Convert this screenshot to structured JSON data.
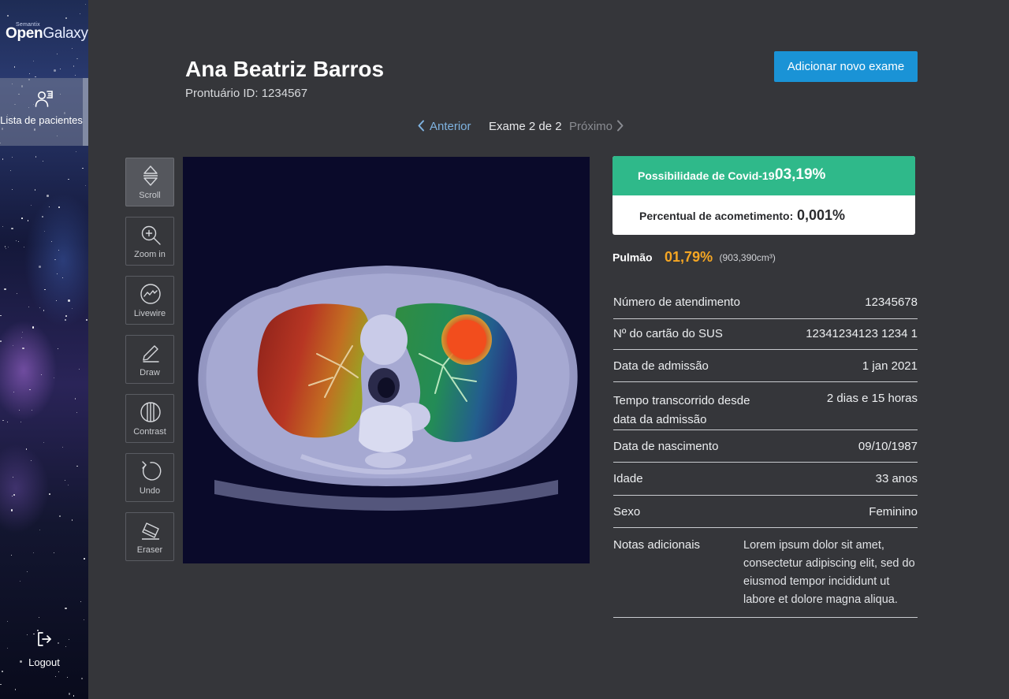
{
  "brand": {
    "sub": "Semantix",
    "name_bold": "Open",
    "name_light": "Galaxy"
  },
  "sidebar": {
    "nav_item": {
      "label": "Lista de pacientes",
      "icon": "patients-icon"
    },
    "logout": {
      "label": "Logout",
      "icon": "logout-icon"
    }
  },
  "patient": {
    "name": "Ana Beatriz Barros",
    "record_id": "Prontuário ID: 1234567"
  },
  "header": {
    "add_exam_label": "Adicionar novo exame"
  },
  "exam_nav": {
    "prev": "Anterior",
    "counter": "Exame 2 de 2",
    "next": "Próximo"
  },
  "tools": [
    {
      "label": "Scroll",
      "icon": "scroll-icon",
      "active": true
    },
    {
      "label": "Zoom in",
      "icon": "zoom-in-icon"
    },
    {
      "label": "Livewire",
      "icon": "livewire-icon"
    },
    {
      "label": "Draw",
      "icon": "pencil-icon"
    },
    {
      "label": "Contrast",
      "icon": "contrast-icon"
    },
    {
      "label": "Undo",
      "icon": "undo-icon"
    },
    {
      "label": "Eraser",
      "icon": "eraser-icon"
    }
  ],
  "results": {
    "covid_label": "Possibilidade de Covid-19:",
    "covid_value": "03,19%",
    "involvement_label": "Percentual de acometimento:",
    "involvement_value": "0,001%",
    "covid_color": "#2fb98a"
  },
  "lung": {
    "label": "Pulmão",
    "percent": "01,79%",
    "volume": "(903,390cm³)",
    "percent_color": "#f5a623"
  },
  "info": [
    {
      "key": "Número de atendimento",
      "value": "12345678"
    },
    {
      "key": "Nº do cartão do SUS",
      "value": "12341234123 1234 1"
    },
    {
      "key": "Data de admissão",
      "value": "1 jan 2021"
    },
    {
      "key": "Tempo transcorrido desde data da admissão",
      "value": "2 dias e 15 horas"
    },
    {
      "key": "Data de nascimento",
      "value": "09/10/1987"
    },
    {
      "key": "Idade",
      "value": "33 anos"
    },
    {
      "key": "Sexo",
      "value": "Feminino"
    }
  ],
  "notes": {
    "key": "Notas adicionais",
    "value": "Lorem ipsum dolor sit amet, consectetur adipiscing elit, sed do eiusmod tempor incididunt ut labore et dolore magna aliqua."
  },
  "colors": {
    "accent": "#1a93d6",
    "background": "#35363a"
  }
}
